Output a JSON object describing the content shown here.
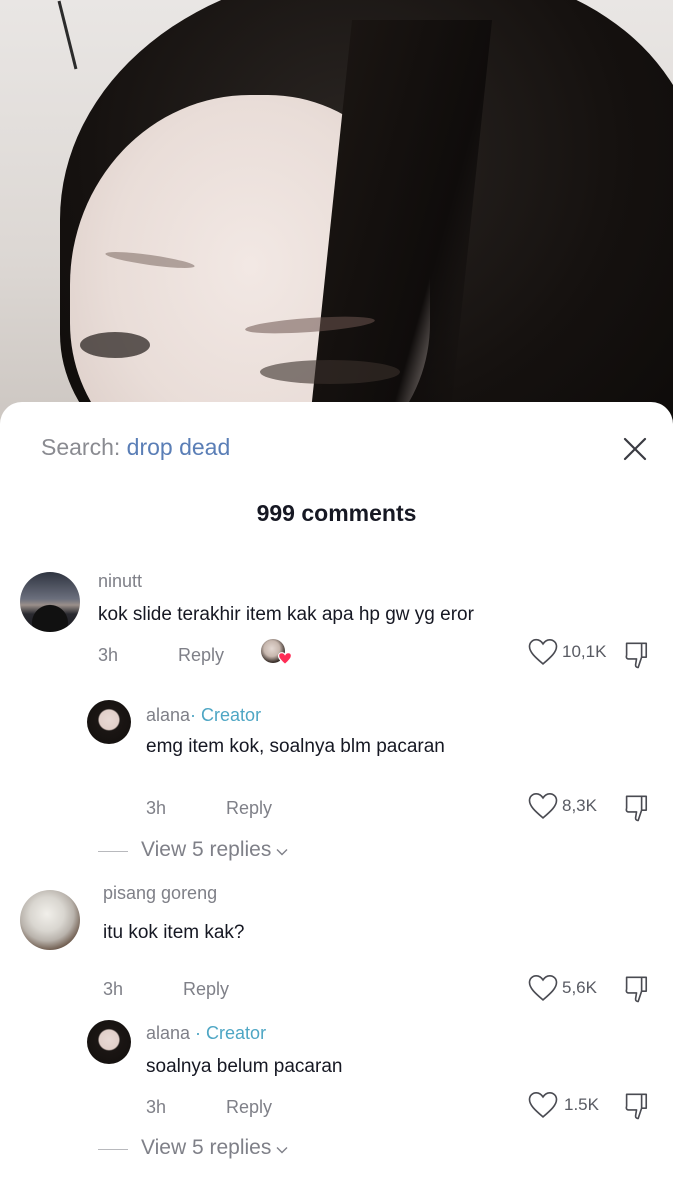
{
  "search": {
    "label": "Search: ",
    "query": "drop dead"
  },
  "comments_count": "999 comments",
  "comments": [
    {
      "username": "ninutt",
      "text": "kok slide terakhir item kak apa hp gw yg eror",
      "time": "3h",
      "reply_label": "Reply",
      "likes": "10,1K",
      "liked_by_creator": true,
      "reply": {
        "username": "alana",
        "badge": "· Creator",
        "text": "emg item kok, soalnya blm pacaran",
        "time": "3h",
        "reply_label": "Reply",
        "likes": "8,3K"
      },
      "view_replies": "View 5 replies"
    },
    {
      "username": "pisang goreng",
      "text": "itu kok item kak?",
      "time": "3h",
      "reply_label": "Reply",
      "likes": "5,6K",
      "reply": {
        "username": "alana",
        "badge": " · Creator",
        "text": "soalnya belum pacaran",
        "time": "3h",
        "reply_label": "Reply",
        "likes": "1.5K"
      },
      "view_replies": "View 5 replies"
    }
  ],
  "icons": {
    "close": "close-icon",
    "like": "heart-outline-icon",
    "dislike": "thumbs-down-icon",
    "chevron": "chevron-down-icon"
  },
  "colors": {
    "search_query": "#5a7eb6",
    "creator_badge": "#4ea6c4",
    "creator_like_heart": "#fe2c55"
  }
}
